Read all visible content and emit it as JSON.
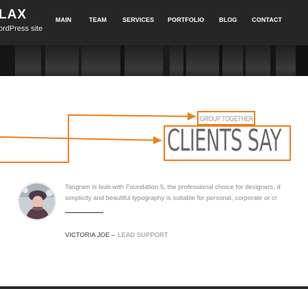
{
  "header": {
    "logo": "LAX",
    "tagline": "ordPress site",
    "nav": [
      "MAIN",
      "TEAM",
      "SERVICES",
      "PORTFOLIO",
      "BLOG",
      "CONTACT"
    ]
  },
  "section": {
    "sub_heading": "GROUP TOGETHER",
    "heading": "CLIENTS SAY"
  },
  "testimonial": {
    "text_line1": "Tangram is built with Foundation 5, the professional choice for designers, d",
    "text_line2": "simplicity and beautiful typography is suitable for personal, corporate or cr",
    "author": "VICTORIA JOE –",
    "role": "LEAD SUPPORT"
  },
  "colors": {
    "annotation": "#f07d19",
    "header_bg": "#262626"
  }
}
